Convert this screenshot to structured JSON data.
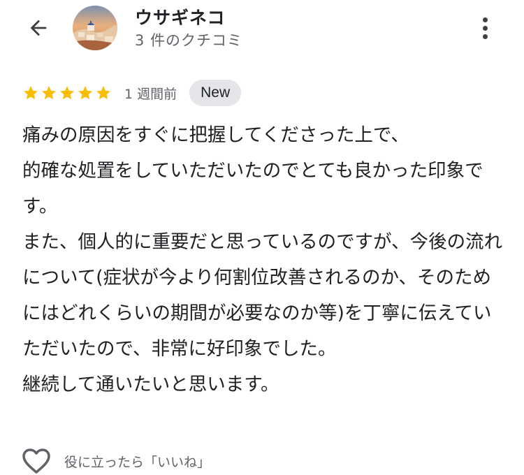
{
  "header": {
    "back_icon": "arrow-back-icon",
    "user_name": "ウサギネコ",
    "review_count": "3 件のクチコミ",
    "more_icon": "more-vert-icon"
  },
  "review": {
    "rating": 5,
    "rating_max": 5,
    "star_color": "#fbbc04",
    "time_ago": "1 週間前",
    "badge": "New",
    "text": "痛みの原因をすぐに把握してくださった上で、\n的確な処置をしていただいたのでとても良かった印象です。\nまた、個人的に重要だと思っているのですが、今後の流れについて(症状が今より何割位改善されるのか、そのためにはどれくらいの期間が必要なのか等)を丁寧に伝えていただいたので、非常に好印象でした。\n継続して通いたいと思います。"
  },
  "actions": {
    "like_icon": "heart-outline-icon",
    "like_label": "役に立ったら「いいね」"
  }
}
